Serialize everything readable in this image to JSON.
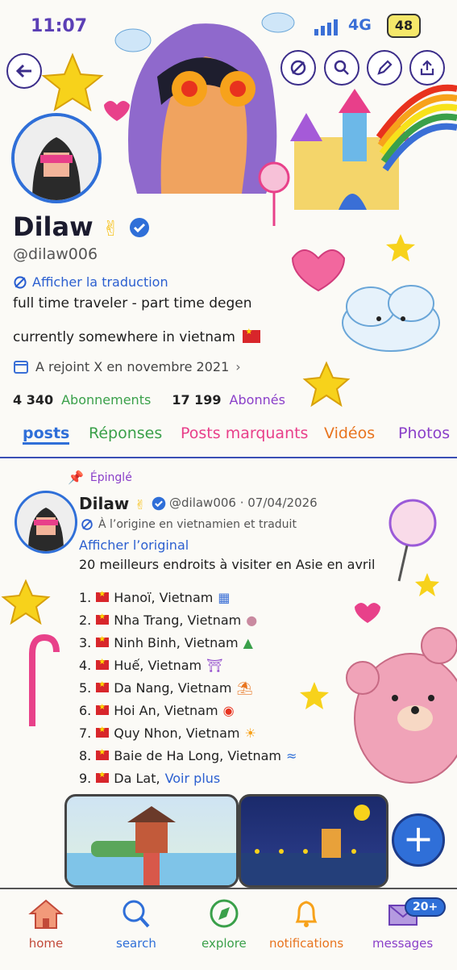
{
  "status": {
    "time": "11:07",
    "network": "4G",
    "battery": "48"
  },
  "profile": {
    "name": "Dilaw",
    "handle": "@dilaw006",
    "translate_label": "Afficher la traduction",
    "bio_line1": "full time traveler - part time degen",
    "bio_line2": "currently somewhere in vietnam",
    "joined": "A rejoint X en novembre 2021",
    "following_count": "4 340",
    "following_label": "Abonnements",
    "followers_count": "17 199",
    "followers_label": "Abonnés"
  },
  "tabs": [
    "posts",
    "Réponses",
    "Posts marquants",
    "Vidéos",
    "Photos"
  ],
  "post": {
    "pinned_label": "Épinglé",
    "author": "Dilaw",
    "handle_date": "@dilaw006 · 07/04/2026",
    "origin_note": "À l’origine en vietnamien et traduit",
    "show_original": "Afficher l’original",
    "title": "20 meilleurs endroits à visiter en Asie en avril",
    "items": [
      "1.",
      "Hanoï, Vietnam",
      "2.",
      "Nha Trang, Vietnam",
      "3.",
      "Ninh Binh, Vietnam",
      "4.",
      "Huế, Vietnam",
      "5.",
      "Da Nang, Vietnam",
      "6.",
      "Hoi An, Vietnam",
      "7.",
      "Quy Nhon, Vietnam",
      "8.",
      "Baie de Ha Long, Vietnam",
      "9.",
      "Da Lat,"
    ],
    "see_more": "Voir plus"
  },
  "nav": {
    "home": "home",
    "search": "search",
    "explore": "explore",
    "notifications": "notifications",
    "messages": "messages",
    "messages_badge": "20+"
  },
  "colors": {
    "accent": "#2f6fd8",
    "purple": "#8a3fc9",
    "green": "#3aa04a",
    "pink": "#e83f8a",
    "orange": "#e8741f"
  },
  "icons": [
    "back-arrow-icon",
    "no-translate-icon",
    "search-icon",
    "pencil-icon",
    "share-icon",
    "calendar-icon",
    "pin-icon",
    "verified-icon",
    "muscle-icon",
    "plus-icon",
    "home-icon",
    "explore-icon",
    "bell-icon",
    "mail-icon"
  ]
}
